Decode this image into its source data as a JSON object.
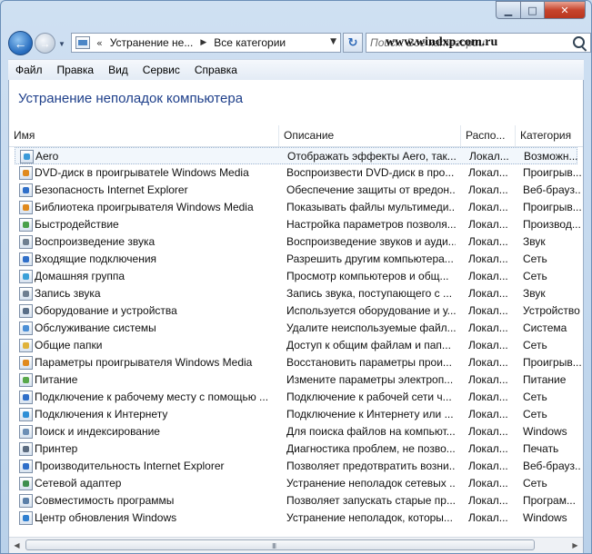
{
  "window": {
    "caption_buttons": {
      "minimize": "▁",
      "maximize": "□",
      "close": "✕"
    }
  },
  "nav": {
    "back": "←",
    "forward": "→",
    "recent": "▼",
    "address": {
      "chevron": "«",
      "segments": [
        "Устранение не...",
        "Все категории"
      ],
      "separator": "▶",
      "dropdown": "▼"
    },
    "refresh": "↻",
    "search_placeholder": "Поиск: Все категории",
    "watermark": "www.windxp.com.ru"
  },
  "menu": [
    "Файл",
    "Правка",
    "Вид",
    "Сервис",
    "Справка"
  ],
  "page_title": "Устранение неполадок компьютера",
  "columns": [
    "Имя",
    "Описание",
    "Распо...",
    "Категория"
  ],
  "rows": [
    {
      "name": "Aero",
      "desc": "Отображать эффекты Aero, так...",
      "loc": "Локал...",
      "cat": "Возможн...",
      "icon": "aero-icon",
      "color": "#3a9ad9"
    },
    {
      "name": "DVD-диск в проигрыватele Windows Media",
      "desc": "Воспроизвести DVD-диск в про...",
      "loc": "Локал...",
      "cat": "Проигрыв...",
      "icon": "dvd-icon",
      "color": "#e08a1e"
    },
    {
      "name": "Безопасность Internet Explorer",
      "desc": "Обеспечение защиты от вредон...",
      "loc": "Локал...",
      "cat": "Веб-брауз...",
      "icon": "ie-shield-icon",
      "color": "#2f6fc9"
    },
    {
      "name": "Библиотека проигрывателя Windows Media",
      "desc": "Показывать файлы мультимеди...",
      "loc": "Локал...",
      "cat": "Проигрыв...",
      "icon": "media-library-icon",
      "color": "#e08a1e"
    },
    {
      "name": "Быстродействие",
      "desc": "Настройка параметров позволя...",
      "loc": "Локал...",
      "cat": "Производ...",
      "icon": "performance-icon",
      "color": "#4aa14a"
    },
    {
      "name": "Воспроизведение звука",
      "desc": "Воспроизведение звуков и ауди...",
      "loc": "Локал...",
      "cat": "Звук",
      "icon": "speaker-icon",
      "color": "#6f7f91"
    },
    {
      "name": "Входящие подключения",
      "desc": "Разрешить другим компьютера...",
      "loc": "Локал...",
      "cat": "Сеть",
      "icon": "network-icon",
      "color": "#2f6fc9"
    },
    {
      "name": "Домашняя группа",
      "desc": "Просмотр компьютеров и общ...",
      "loc": "Локал...",
      "cat": "Сеть",
      "icon": "homegroup-icon",
      "color": "#3aa0d8"
    },
    {
      "name": "Запись звука",
      "desc": "Запись звука, поступающего с ...",
      "loc": "Локал...",
      "cat": "Звук",
      "icon": "microphone-icon",
      "color": "#6f7f91"
    },
    {
      "name": "Оборудование и устройства",
      "desc": "Используется оборудование и у...",
      "loc": "Локал...",
      "cat": "Устройство",
      "icon": "devices-icon",
      "color": "#5a6f88"
    },
    {
      "name": "Обслуживание системы",
      "desc": "Удалите неиспользуемые файл...",
      "loc": "Локал...",
      "cat": "Система",
      "icon": "maintenance-icon",
      "color": "#4b8fd6"
    },
    {
      "name": "Общие папки",
      "desc": "Доступ к общим файлам и пап...",
      "loc": "Локал...",
      "cat": "Сеть",
      "icon": "shared-folder-icon",
      "color": "#e0b23a"
    },
    {
      "name": "Параметры проигрывателя Windows Media",
      "desc": "Восстановить параметры прои...",
      "loc": "Локал...",
      "cat": "Проигрыв...",
      "icon": "media-settings-icon",
      "color": "#e08a1e"
    },
    {
      "name": "Питание",
      "desc": "Измените параметры электроп...",
      "loc": "Локал...",
      "cat": "Питание",
      "icon": "power-icon",
      "color": "#58a84a"
    },
    {
      "name": "Подключение к рабочему месту с помощью ...",
      "desc": "Подключение к рабочей сети ч...",
      "loc": "Локал...",
      "cat": "Сеть",
      "icon": "workplace-icon",
      "color": "#2f6fc9"
    },
    {
      "name": "Подключения к Интернету",
      "desc": "Подключение к Интернету или ...",
      "loc": "Локал...",
      "cat": "Сеть",
      "icon": "internet-icon",
      "color": "#2f8fd6"
    },
    {
      "name": "Поиск и индексирование",
      "desc": "Для поиска файлов на компьют...",
      "loc": "Локал...",
      "cat": "Windows",
      "icon": "search-index-icon",
      "color": "#6d8fb5"
    },
    {
      "name": "Принтер",
      "desc": "Диагностика проблем, не позво...",
      "loc": "Локал...",
      "cat": "Печать",
      "icon": "printer-icon",
      "color": "#5c6c80"
    },
    {
      "name": "Производительность Internet Explorer",
      "desc": "Позволяет предотвратить возни...",
      "loc": "Локал...",
      "cat": "Веб-брауз...",
      "icon": "ie-performance-icon",
      "color": "#2f6fc9"
    },
    {
      "name": "Сетевой адаптер",
      "desc": "Устранение неполадок сетевых ...",
      "loc": "Локал...",
      "cat": "Сеть",
      "icon": "network-adapter-icon",
      "color": "#3f8f4f"
    },
    {
      "name": "Совместимость программы",
      "desc": "Позволяет запускать старые пр...",
      "loc": "Локал...",
      "cat": "Програм...",
      "icon": "compatibility-icon",
      "color": "#5b7fa8"
    },
    {
      "name": "Центр обновления Windows",
      "desc": "Устранение неполадок, которы...",
      "loc": "Локал...",
      "cat": "Windows",
      "icon": "windows-update-icon",
      "color": "#2f7fd0"
    }
  ],
  "scroll": {
    "left": "◀",
    "right": "▶",
    "grip": "III"
  }
}
